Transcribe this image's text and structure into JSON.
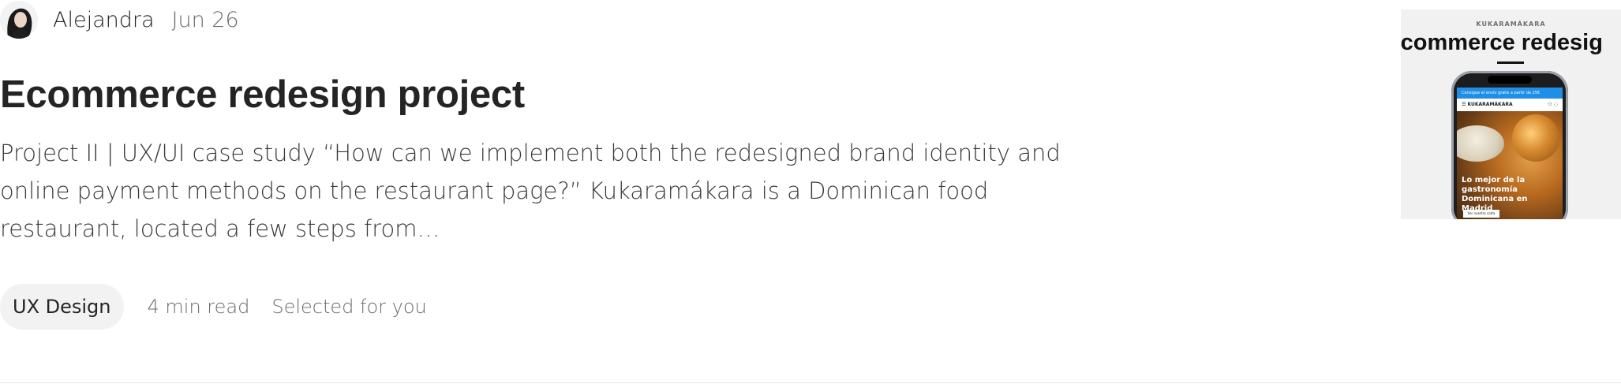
{
  "author": {
    "name": "Alejandra",
    "date": "Jun 26",
    "avatar_icon": "person-avatar-icon"
  },
  "post": {
    "title": "Ecommerce redesign project",
    "excerpt": "Project II | UX/UI case study “How can we implement both the redesigned brand identity and online payment methods on the restaurant page?” Kukaramákara is a Dominican food restaurant, located a few steps from…"
  },
  "meta": {
    "tag": "UX Design",
    "read_time": "4 min read",
    "note": "Selected for you"
  },
  "thumbnail": {
    "brand": "KUKARAMÁKARA",
    "heading": "-commerce redesig",
    "banner_text": "Consigue el envío gratis a partir de 25€",
    "nav_brand": "☰ KUKARAMÁKARA",
    "hero_text": "Lo mejor de la gastronomía Dominicana en Madrid",
    "hero_button": "Ver nuestra carta",
    "accent_color": "#1e8ee6"
  }
}
